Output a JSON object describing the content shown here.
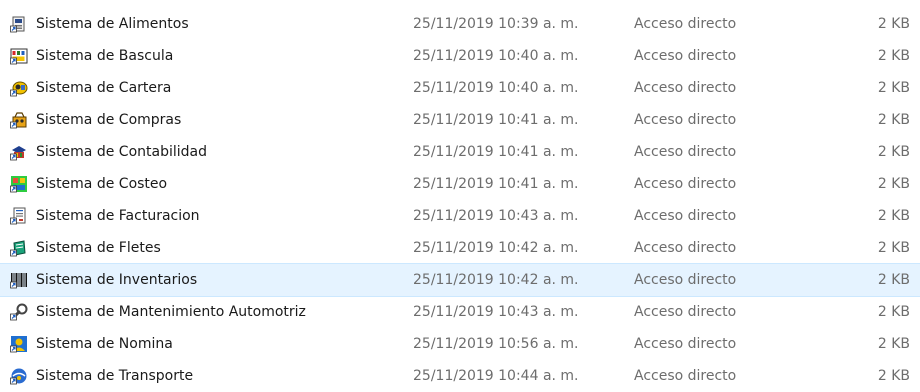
{
  "files": [
    {
      "name": "Sistema de Alimentos",
      "date": "25/11/2019 10:39 a. m.",
      "type": "Acceso directo",
      "size": "2 KB",
      "icon": "alimentos-icon"
    },
    {
      "name": "Sistema de Bascula",
      "date": "25/11/2019 10:40 a. m.",
      "type": "Acceso directo",
      "size": "2 KB",
      "icon": "bascula-icon"
    },
    {
      "name": "Sistema de Cartera",
      "date": "25/11/2019 10:40 a. m.",
      "type": "Acceso directo",
      "size": "2 KB",
      "icon": "cartera-icon"
    },
    {
      "name": "Sistema de Compras",
      "date": "25/11/2019 10:41 a. m.",
      "type": "Acceso directo",
      "size": "2 KB",
      "icon": "compras-icon"
    },
    {
      "name": "Sistema de Contabilidad",
      "date": "25/11/2019 10:41 a. m.",
      "type": "Acceso directo",
      "size": "2 KB",
      "icon": "contabilidad-icon"
    },
    {
      "name": "Sistema de Costeo",
      "date": "25/11/2019 10:41 a. m.",
      "type": "Acceso directo",
      "size": "2 KB",
      "icon": "costeo-icon"
    },
    {
      "name": "Sistema de Facturacion",
      "date": "25/11/2019 10:43 a. m.",
      "type": "Acceso directo",
      "size": "2 KB",
      "icon": "facturacion-icon"
    },
    {
      "name": "Sistema de Fletes",
      "date": "25/11/2019 10:42 a. m.",
      "type": "Acceso directo",
      "size": "2 KB",
      "icon": "fletes-icon"
    },
    {
      "name": "Sistema de Inventarios",
      "date": "25/11/2019 10:42 a. m.",
      "type": "Acceso directo",
      "size": "2 KB",
      "icon": "barcode-icon",
      "selected": true
    },
    {
      "name": "Sistema de Mantenimiento Automotriz",
      "date": "25/11/2019 10:43 a. m.",
      "type": "Acceso directo",
      "size": "2 KB",
      "icon": "wrench-icon"
    },
    {
      "name": "Sistema de Nomina",
      "date": "25/11/2019 10:56 a. m.",
      "type": "Acceso directo",
      "size": "2 KB",
      "icon": "nomina-icon"
    },
    {
      "name": "Sistema de Transporte",
      "date": "25/11/2019 10:44 a. m.",
      "type": "Acceso directo",
      "size": "2 KB",
      "icon": "transporte-icon"
    }
  ],
  "colors": {
    "selection_bg": "#e5f3ff",
    "selection_border": "#cce8ff",
    "secondary_text": "#6d6d6d"
  }
}
